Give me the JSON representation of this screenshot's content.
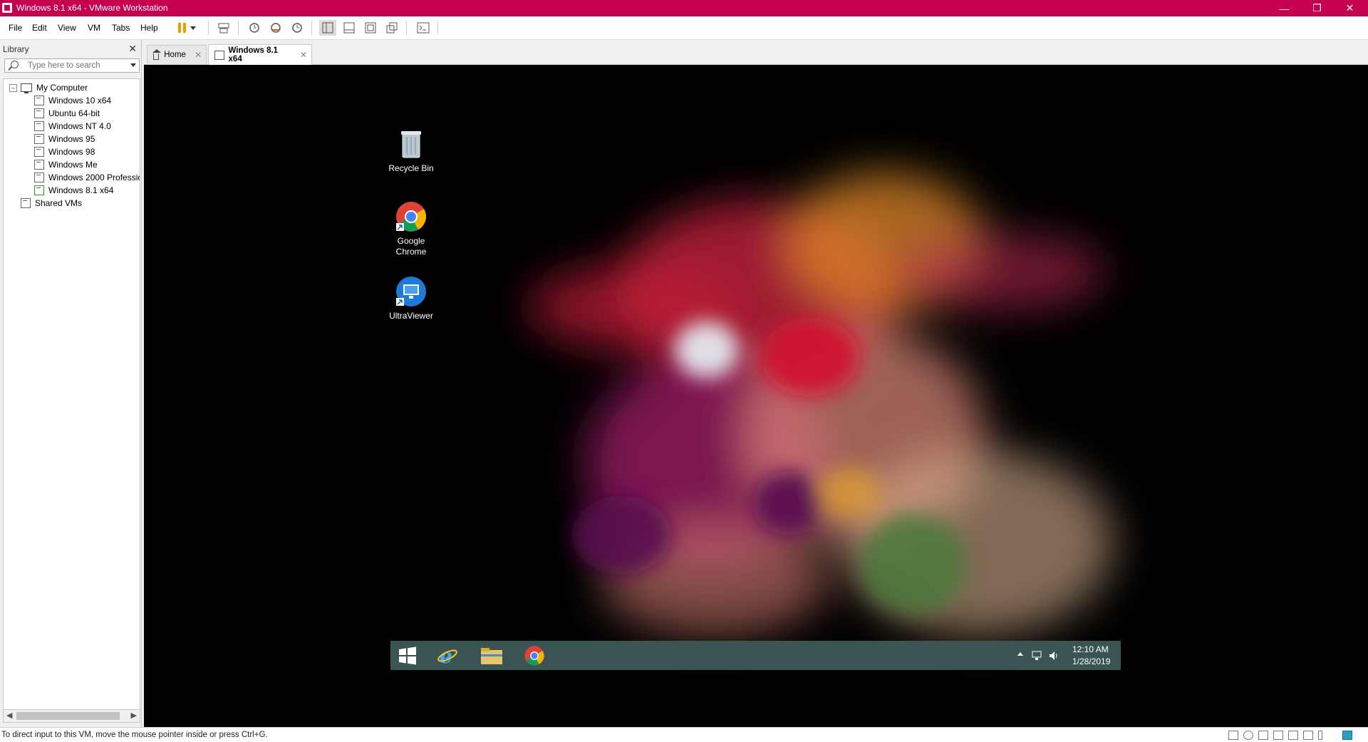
{
  "window": {
    "title": "Windows 8.1 x64 - VMware Workstation",
    "accent": "#c4004f"
  },
  "menu": [
    "File",
    "Edit",
    "View",
    "VM",
    "Tabs",
    "Help"
  ],
  "library": {
    "header": "Library",
    "search_placeholder": "Type here to search",
    "root": "My Computer",
    "items": [
      "Windows 10 x64",
      "Ubuntu 64-bit",
      "Windows NT 4.0",
      "Windows 95",
      "Windows 98",
      "Windows Me",
      "Windows 2000 Professio",
      "Windows 8.1 x64"
    ],
    "shared": "Shared VMs"
  },
  "tabs": [
    {
      "label": "Home"
    },
    {
      "label": "Windows 8.1 x64"
    }
  ],
  "desktop": {
    "icons": [
      "Recycle Bin",
      "Google Chrome",
      "UltraViewer"
    ]
  },
  "taskbar": {
    "time": "12:10 AM",
    "date": "1/28/2019"
  },
  "status": {
    "message": "To direct input to this VM, move the mouse pointer inside or press Ctrl+G."
  }
}
